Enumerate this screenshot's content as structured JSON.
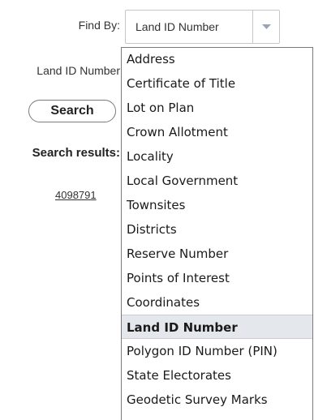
{
  "form": {
    "find_by_label": "Find By:",
    "land_id_label": "Land ID Number",
    "search_button": "Search",
    "results_label": "Search results:",
    "results": [
      "4098791"
    ]
  },
  "select": {
    "value": "Land ID Number",
    "arrow_icon": "chevron-down-icon",
    "arrow_color": "#9aa4b2"
  },
  "dropdown": {
    "options": [
      "Address",
      "Certificate of Title",
      "Lot on Plan",
      "Crown Allotment",
      "Locality",
      "Local Government",
      "Townsites",
      "Districts",
      "Reserve Number",
      "Points of Interest",
      "Coordinates",
      "Land ID Number",
      "Polygon ID Number (PIN)",
      "State Electorates",
      "Geodetic Survey Marks"
    ],
    "selected": "Land ID Number",
    "selected_background": "#e4e7ec"
  }
}
